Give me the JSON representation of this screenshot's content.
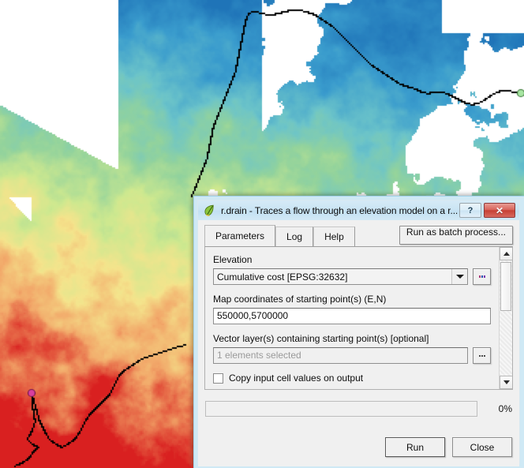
{
  "window": {
    "title": "r.drain - Traces a flow through an elevation model on a r...",
    "icon": "grass-leaf-icon",
    "help_button_label": "?",
    "close_button_label": "✕"
  },
  "tabs": [
    {
      "label": "Parameters",
      "active": true
    },
    {
      "label": "Log",
      "active": false
    },
    {
      "label": "Help",
      "active": false
    }
  ],
  "toolbar": {
    "batch_label": "Run as batch process..."
  },
  "fields": {
    "elevation": {
      "label": "Elevation",
      "value": "Cumulative cost [EPSG:32632]",
      "browse_label": "...",
      "dropdown_icon": "chevron-down-icon"
    },
    "map_coordinates": {
      "label": "Map coordinates of starting point(s) (E,N)",
      "value": "550000,5700000",
      "placeholder": ""
    },
    "vector_layers": {
      "label": "Vector layer(s) containing starting point(s) [optional]",
      "value": "1 elements selected",
      "browse_label": "...",
      "disabled": true
    },
    "copy_input": {
      "label": "Copy input cell values on output",
      "checked": false
    }
  },
  "scrollbar": {
    "up_icon": "triangle-up-icon",
    "down_icon": "triangle-down-icon"
  },
  "progress": {
    "percent_label": "0%",
    "value": 0
  },
  "actions": {
    "run_label": "Run",
    "close_label": "Close"
  },
  "map": {
    "layer_name": "Cumulative cost",
    "start_point_color": "#d93fa0",
    "end_point_color": "#a8e6a3",
    "drain_path_color": "#000000",
    "nodata_color": "#ffffff",
    "ramp": [
      {
        "stop": 0.0,
        "color": "#1f74b8"
      },
      {
        "stop": 0.18,
        "color": "#3a9ccd"
      },
      {
        "stop": 0.34,
        "color": "#6cc4c9"
      },
      {
        "stop": 0.48,
        "color": "#93d39c"
      },
      {
        "stop": 0.62,
        "color": "#cde88f"
      },
      {
        "stop": 0.74,
        "color": "#f4e48c"
      },
      {
        "stop": 0.86,
        "color": "#f2a96a"
      },
      {
        "stop": 1.0,
        "color": "#d92020"
      }
    ]
  }
}
